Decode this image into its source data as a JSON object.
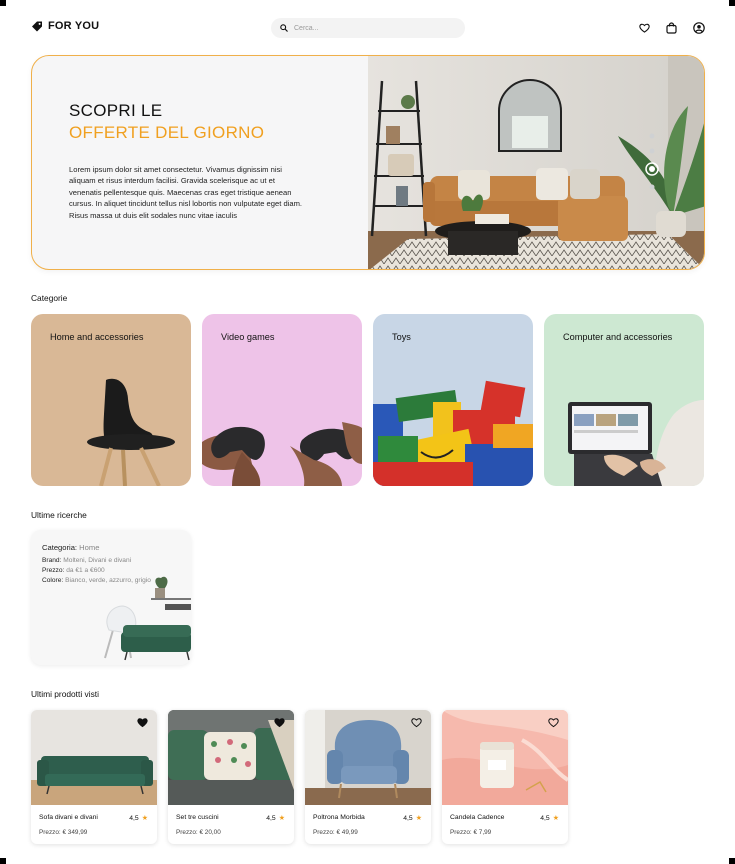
{
  "brand": {
    "name": "FOR YOU"
  },
  "search": {
    "placeholder": "Cerca..."
  },
  "hero": {
    "title_line1": "SCOPRI LE",
    "title_line2": "OFFERTE DEL GIORNO",
    "body": "Lorem ipsum dolor sit amet consectetur. Vivamus dignissim nisi aliquam et risus interdum facilisi. Gravida scelerisque ac ut et venenatis pellentesque quis. Maecenas cras eget tristique aenean cursus. In aliquet tincidunt tellus nisl lobortis non vulputate eget diam. Risus massa ut duis elit sodales nunc vitae iaculis",
    "slide_count": 5,
    "active_slide": 3
  },
  "categories": {
    "title": "Categorie",
    "items": [
      {
        "label": "Home and accessories",
        "bg": "#d9b896"
      },
      {
        "label": "Video games",
        "bg": "#eec3e8"
      },
      {
        "label": "Toys",
        "bg": "#c8d6e6"
      },
      {
        "label": "Computer and accessories",
        "bg": "#cde8d2"
      }
    ]
  },
  "recent_searches": {
    "title": "Ultime ricerche",
    "card": {
      "category_label": "Categoria:",
      "category_value": "Home",
      "brand_label": "Brand:",
      "brand_value": "Molteni, Divani e divani",
      "price_label": "Prezzo:",
      "price_value": "da €1 a €600",
      "color_label": "Colore:",
      "color_value": "Bianco, verde, azzurro, grigio"
    }
  },
  "recent_products": {
    "title": "Ultimi prodotti visti",
    "items": [
      {
        "name": "Sofa divani e divani",
        "rating": "4,5",
        "price": "Prezzo: € 349,99",
        "favorite": true
      },
      {
        "name": "Set tre cuscini",
        "rating": "4,5",
        "price": "Prezzo: € 20,00",
        "favorite": true
      },
      {
        "name": "Poltrona Morbida",
        "rating": "4,5",
        "price": "Prezzo: € 49,99",
        "favorite": false
      },
      {
        "name": "Candela Cadence",
        "rating": "4,5",
        "price": "Prezzo: € 7,99",
        "favorite": false
      }
    ]
  },
  "colors": {
    "accent": "#f0a020",
    "hero_border": "#f0b04a"
  }
}
